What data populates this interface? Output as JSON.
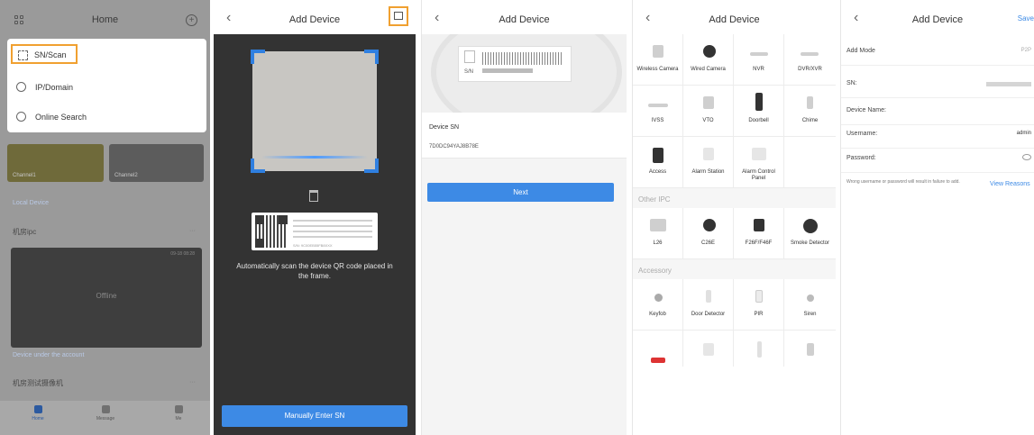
{
  "home": {
    "title": "Home",
    "menu": [
      {
        "label": "SN/Scan",
        "icon": "scan-icon"
      },
      {
        "label": "IP/Domain",
        "icon": "ip-icon"
      },
      {
        "label": "Online Search",
        "icon": "globe-icon"
      }
    ],
    "cameras": [
      "Channel1",
      "Channel2"
    ],
    "local_device": "Local Device",
    "group1": "机房ipc",
    "offline": "Offline",
    "offline_time": "09-18 08:28",
    "device_under_account": "Device under the account",
    "group2": "机房测试摄像机",
    "nav": [
      "Home",
      "Message",
      "Me"
    ],
    "more": "···"
  },
  "scan": {
    "title": "Add Device",
    "qr_sn_text": "S/N: 9C00EB55FB8XXX",
    "hint": "Automatically scan the device QR code placed in the frame.",
    "manual_button": "Manually Enter SN"
  },
  "sn_entry": {
    "title": "Add Device",
    "label_sn_prefix": "S/N",
    "device_sn_label": "Device SN",
    "device_sn_value": "7D0DC94YAJ8B78E",
    "next_button": "Next"
  },
  "device_types": {
    "title": "Add Device",
    "main": [
      "Wireless Camera",
      "Wired Camera",
      "NVR",
      "DVR/XVR",
      "IVSS",
      "VTO",
      "Doorbell",
      "Chime",
      "Access",
      "Alarm Station",
      "Alarm Control Panel"
    ],
    "other_ipc_title": "Other IPC",
    "other_ipc": [
      "L26",
      "C26E",
      "F26F/F46F",
      "Smoke Detector"
    ],
    "accessory_title": "Accessory",
    "accessory": [
      "Keyfob",
      "Door Detector",
      "PIR",
      "Siren"
    ]
  },
  "device_info": {
    "title": "Add Device",
    "save": "Save",
    "add_mode_label": "Add Mode",
    "add_mode_value": "P2P",
    "sn_label": "SN:",
    "name_label": "Device Name:",
    "username_label": "Username:",
    "username_value": "admin",
    "password_label": "Password:",
    "warning": "Wrong username or password will result in failure to add.",
    "view_reasons": "View Reasons"
  }
}
